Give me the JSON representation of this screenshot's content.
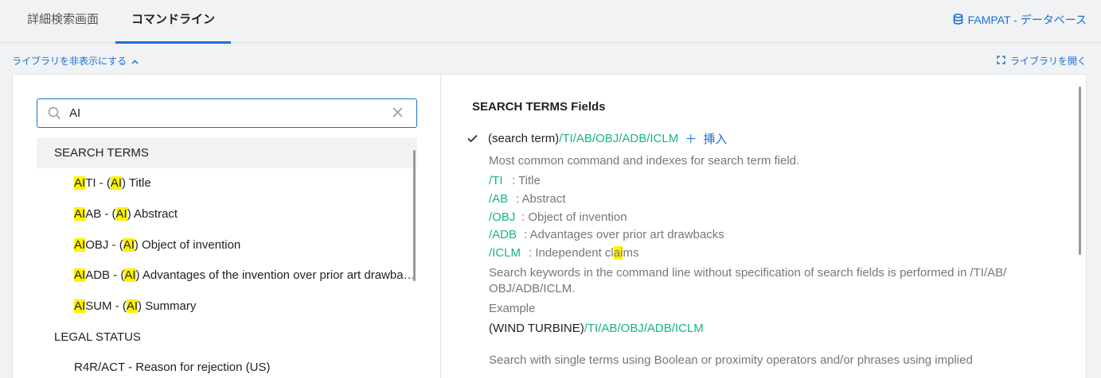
{
  "tabs": [
    {
      "label": "詳細検索画面"
    },
    {
      "label": "コマンドライン"
    }
  ],
  "database_link": "FAMPAT - データベース",
  "library_toggle": "ライブラリを非表示にする",
  "library_open": "ライブラリを開く",
  "search": {
    "value": "AI"
  },
  "groups": [
    {
      "title": "SEARCH TERMS",
      "items": [
        {
          "pre": "",
          "hl1": "AI",
          "mid": "TI - (",
          "hl2": "AI",
          "post": ") Title"
        },
        {
          "pre": "",
          "hl1": "AI",
          "mid": "AB - (",
          "hl2": "AI",
          "post": ") Abstract"
        },
        {
          "pre": "",
          "hl1": "AI",
          "mid": "OBJ - (",
          "hl2": "AI",
          "post": ") Object of invention"
        },
        {
          "pre": "",
          "hl1": "AI",
          "mid": "ADB - (",
          "hl2": "AI",
          "post": ") Advantages of the invention over prior art drawbacks"
        },
        {
          "pre": "",
          "hl1": "AI",
          "mid": "SUM - (",
          "hl2": "AI",
          "post": ") Summary"
        }
      ]
    },
    {
      "title": "LEGAL STATUS",
      "items": [
        {
          "pre": "",
          "hl1": "",
          "mid": "R4R/ACT - Reason for rejection (US)",
          "hl2": "",
          "post": ""
        }
      ]
    }
  ],
  "detail": {
    "section_title": "SEARCH TERMS Fields",
    "term_prefix": "(search term)",
    "term_fields": "/TI/AB/OBJ/ADB/ICLM",
    "insert_label": "挿入",
    "description": "Most common command and indexes for search term field.",
    "fields": [
      {
        "code": "/TI",
        "desc": ": Title"
      },
      {
        "code": "/AB",
        "desc": ": Abstract"
      },
      {
        "code": "/OBJ",
        "desc": ": Object of invention"
      },
      {
        "code": "/ADB",
        "desc": ": Advantages over prior art drawbacks"
      },
      {
        "code": "/ICLM",
        "desc_pre": ": Independent cl",
        "desc_hl": "ai",
        "desc_post": "ms"
      }
    ],
    "note_line1": "Search  keywords in the command line without specification of search fields is performed in /TI/AB/",
    "note_line2": "OBJ/ADB/ICLM.",
    "example_label": "Example",
    "example_prefix": "(WIND TURBINE)",
    "example_fields": "/TI/AB/OBJ/ADB/ICLM",
    "more_text": "Search with single terms using Boolean or proximity operators and/or phrases using implied"
  }
}
